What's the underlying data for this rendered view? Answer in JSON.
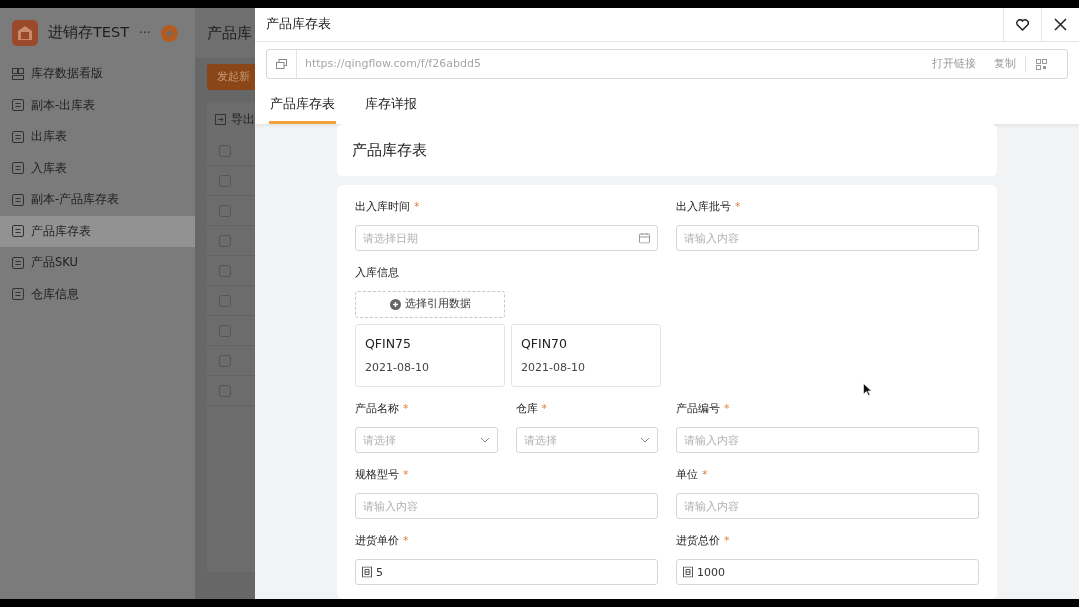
{
  "app": {
    "name": "进销存TEST",
    "more": "···"
  },
  "sidebar": {
    "items": [
      {
        "label": "库存数据看版",
        "kind": "dashboard",
        "selected": false
      },
      {
        "label": "副本-出库表",
        "kind": "form",
        "selected": false
      },
      {
        "label": "出库表",
        "kind": "form",
        "selected": false
      },
      {
        "label": "入库表",
        "kind": "form",
        "selected": false
      },
      {
        "label": "副本-产品库存表",
        "kind": "form",
        "selected": false
      },
      {
        "label": "产品库存表",
        "kind": "form",
        "selected": true
      },
      {
        "label": "产品SKU",
        "kind": "form",
        "selected": false
      },
      {
        "label": "仓库信息",
        "kind": "form",
        "selected": false
      }
    ]
  },
  "background_page": {
    "title": "产品库",
    "primary_button": "发起新",
    "export": "导出",
    "rows": [
      {
        "checked": false
      },
      {
        "checked": false
      },
      {
        "checked": false
      },
      {
        "checked": false
      },
      {
        "checked": false
      },
      {
        "checked": false
      },
      {
        "checked": false
      },
      {
        "checked": false
      },
      {
        "checked": false
      }
    ]
  },
  "drawer": {
    "title": "产品库存表",
    "url": "https://qingflow.com/f/f26abdd5",
    "open_link": "打开链接",
    "copy": "复制",
    "tabs": [
      {
        "label": "产品库存表",
        "selected": true
      },
      {
        "label": "库存详报",
        "selected": false
      }
    ],
    "form_title": "产品库存表",
    "fields": [
      {
        "kind": "date",
        "label": "出入库时间",
        "required_mark": "*",
        "placeholder": "请选择日期"
      },
      {
        "kind": "text",
        "label": "出入库批号",
        "required_mark": "*",
        "placeholder": "请输入内容"
      },
      {
        "kind": "reference",
        "label": "入库信息",
        "button": "选择引用数据",
        "records": [
          {
            "code": "QFIN75",
            "date": "2021-08-10"
          },
          {
            "code": "QFIN70",
            "date": "2021-08-10"
          }
        ]
      },
      {
        "kind": "select",
        "label": "产品名称",
        "required_mark": "*",
        "placeholder": "请选择"
      },
      {
        "kind": "select",
        "label": "仓库",
        "required_mark": "*",
        "placeholder": "请选择"
      },
      {
        "kind": "text",
        "label": "产品编号",
        "required_mark": "*",
        "placeholder": "请输入内容"
      },
      {
        "kind": "text",
        "label": "规格型号",
        "required_mark": "*",
        "placeholder": "请输入内容"
      },
      {
        "kind": "text",
        "label": "单位",
        "required_mark": "*",
        "placeholder": "请输入内容"
      },
      {
        "kind": "number",
        "label": "进货单价",
        "required_mark": "*",
        "value": "5"
      },
      {
        "kind": "number",
        "label": "进货总价",
        "required_mark": "*",
        "value": "1000"
      }
    ]
  }
}
